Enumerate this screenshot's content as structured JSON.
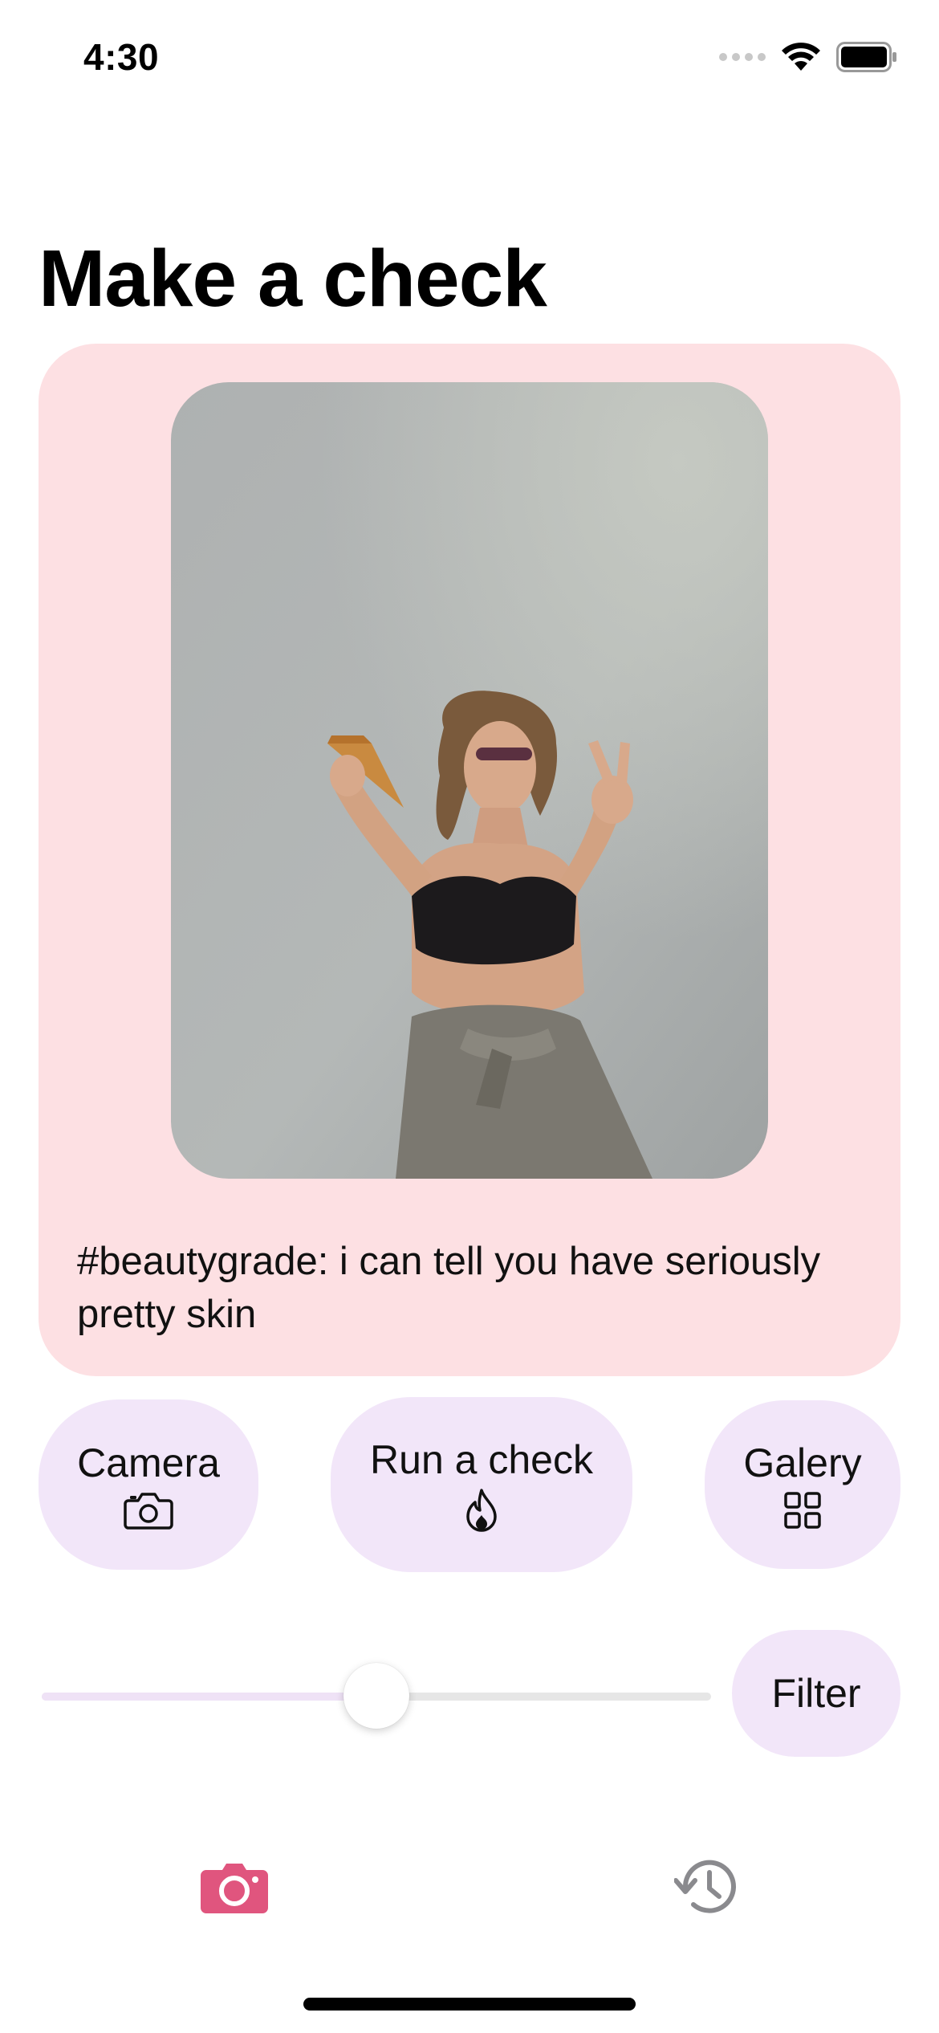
{
  "status_bar": {
    "time": "4:30"
  },
  "page": {
    "title": "Make a check"
  },
  "card": {
    "caption": "#beautygrade: i can tell you have seriously pretty skin"
  },
  "actions": {
    "camera_label": "Camera",
    "run_label": "Run a check",
    "galery_label": "Galery"
  },
  "slider": {
    "value_fraction": 0.5
  },
  "filter": {
    "label": "Filter"
  },
  "tab_bar": {
    "items": [
      {
        "icon": "camera-icon",
        "selected": true
      },
      {
        "icon": "history-icon",
        "selected": false
      }
    ]
  },
  "colors": {
    "card_bg": "#fde0e3",
    "button_bg": "#f2e6f9",
    "accent": "#e0557e",
    "inactive_icon": "#8a8a8e"
  }
}
